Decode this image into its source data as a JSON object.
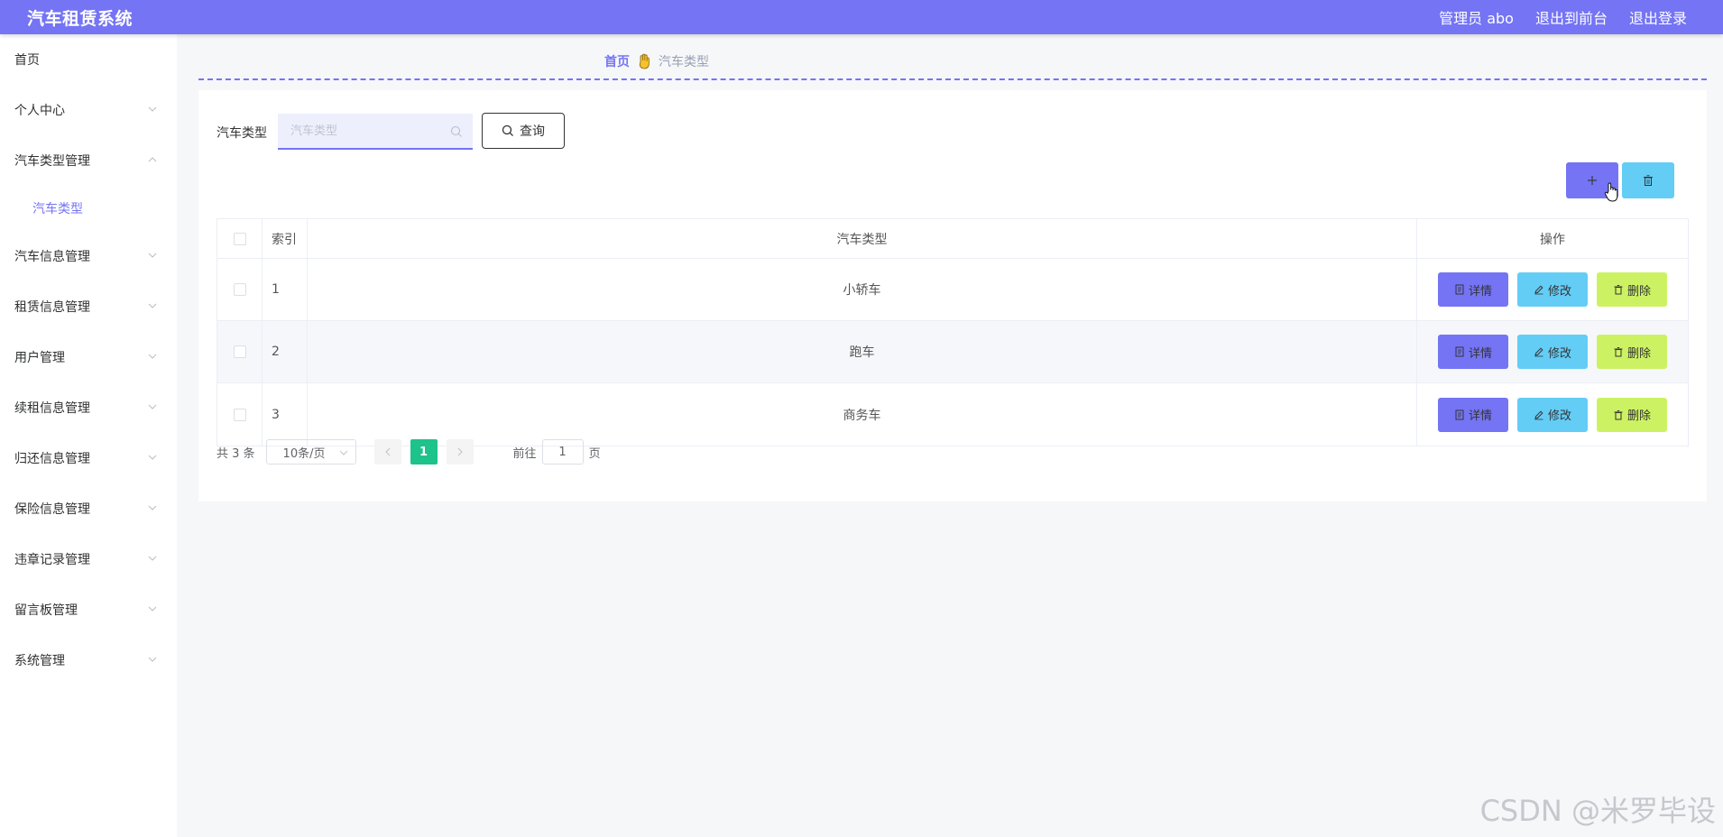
{
  "header": {
    "title": "汽车租赁系统",
    "user": "管理员 abo",
    "to_front": "退出到前台",
    "logout": "退出登录"
  },
  "sidebar": {
    "items": [
      {
        "label": "首页",
        "expandable": false
      },
      {
        "label": "个人中心",
        "expandable": true,
        "expanded": false
      },
      {
        "label": "汽车类型管理",
        "expandable": true,
        "expanded": true,
        "children": [
          {
            "label": "汽车类型"
          }
        ]
      },
      {
        "label": "汽车信息管理",
        "expandable": true,
        "expanded": false
      },
      {
        "label": "租赁信息管理",
        "expandable": true,
        "expanded": false
      },
      {
        "label": "用户管理",
        "expandable": true,
        "expanded": false
      },
      {
        "label": "续租信息管理",
        "expandable": true,
        "expanded": false
      },
      {
        "label": "归还信息管理",
        "expandable": true,
        "expanded": false
      },
      {
        "label": "保险信息管理",
        "expandable": true,
        "expanded": false
      },
      {
        "label": "违章记录管理",
        "expandable": true,
        "expanded": false
      },
      {
        "label": "留言板管理",
        "expandable": true,
        "expanded": false
      },
      {
        "label": "系统管理",
        "expandable": true,
        "expanded": false
      }
    ]
  },
  "breadcrumb": {
    "home": "首页",
    "current": "汽车类型"
  },
  "search": {
    "label": "汽车类型",
    "placeholder": "汽车类型",
    "value": "",
    "button": "查询"
  },
  "table": {
    "columns": [
      "索引",
      "汽车类型",
      "操作"
    ],
    "rows": [
      {
        "index": "1",
        "type": "小轿车"
      },
      {
        "index": "2",
        "type": "跑车"
      },
      {
        "index": "3",
        "type": "商务车"
      }
    ],
    "actions": {
      "detail": "详情",
      "edit": "修改",
      "delete": "删除"
    }
  },
  "pagination": {
    "total": "共 3 条",
    "page_size": "10条/页",
    "current_page": "1",
    "goto_prefix": "前往",
    "goto_value": "1",
    "goto_suffix": "页"
  },
  "watermark": "CSDN @米罗毕设",
  "colors": {
    "primary": "#7474f4",
    "info": "#63cdf6",
    "danger_action": "#ccf263",
    "page_active": "#1ec28b"
  }
}
